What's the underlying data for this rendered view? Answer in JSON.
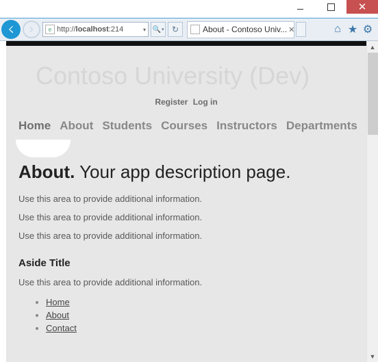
{
  "window": {
    "close": "✕"
  },
  "toolbar": {
    "url_prefix": "http://",
    "url_host": "localhost",
    "url_rest": ":214",
    "search_glyph": "🔍",
    "tab_title": "About - Contoso Univ...",
    "home_glyph": "⌂",
    "star_glyph": "★",
    "gear_glyph": "⚙"
  },
  "page": {
    "site_title": "Contoso University (Dev)",
    "auth": {
      "register": "Register",
      "login": "Log in"
    },
    "nav": [
      "Home",
      "About",
      "Students",
      "Courses",
      "Instructors",
      "Departments"
    ],
    "heading_bold": "About.",
    "heading_rest": " Your app description page.",
    "paras": [
      "Use this area to provide additional information.",
      "Use this area to provide additional information.",
      "Use this area to provide additional information."
    ],
    "aside_title": "Aside Title",
    "aside_para": "Use this area to provide additional information.",
    "links": [
      "Home",
      "About",
      "Contact"
    ]
  }
}
